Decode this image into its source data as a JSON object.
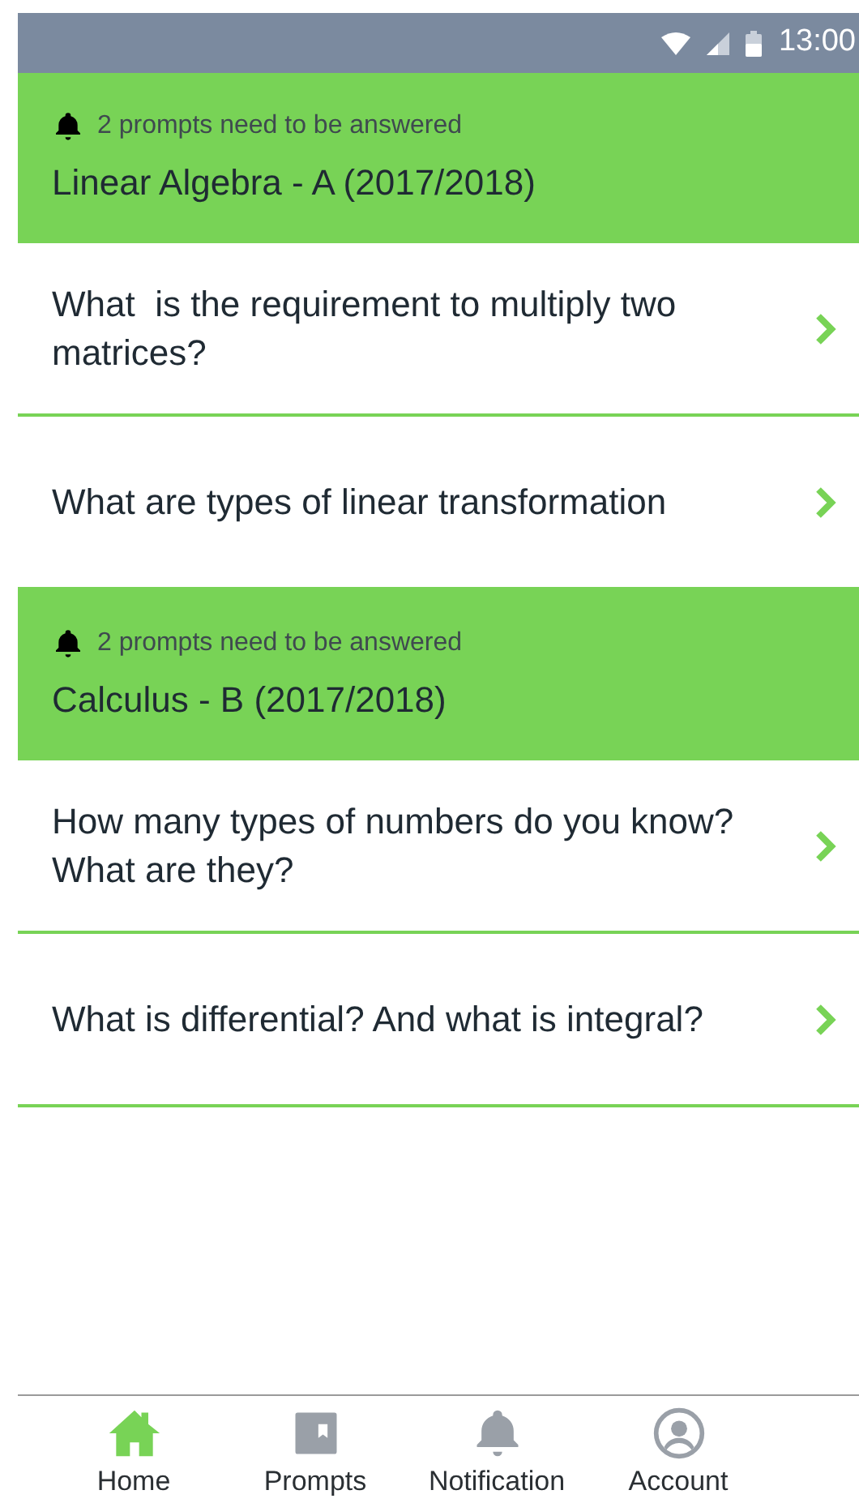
{
  "status_bar": {
    "time": "13:00"
  },
  "courses": [
    {
      "notice": "2 prompts need to be answered",
      "title": "Linear Algebra - A (2017/2018)",
      "prompts": [
        "What  is the requirement to multiply two matrices?",
        "What are types of linear transformation"
      ]
    },
    {
      "notice": "2 prompts need to be answered",
      "title": "Calculus - B (2017/2018)",
      "prompts": [
        "How many types of numbers do you know? What are they?",
        "What is differential? And what is integral?"
      ]
    }
  ],
  "nav": [
    {
      "kind": "home",
      "label": "Home",
      "selected": true
    },
    {
      "kind": "prompts",
      "label": "Prompts",
      "selected": false
    },
    {
      "kind": "notification",
      "label": "Notification",
      "selected": false
    },
    {
      "kind": "account",
      "label": "Account",
      "selected": false
    }
  ]
}
